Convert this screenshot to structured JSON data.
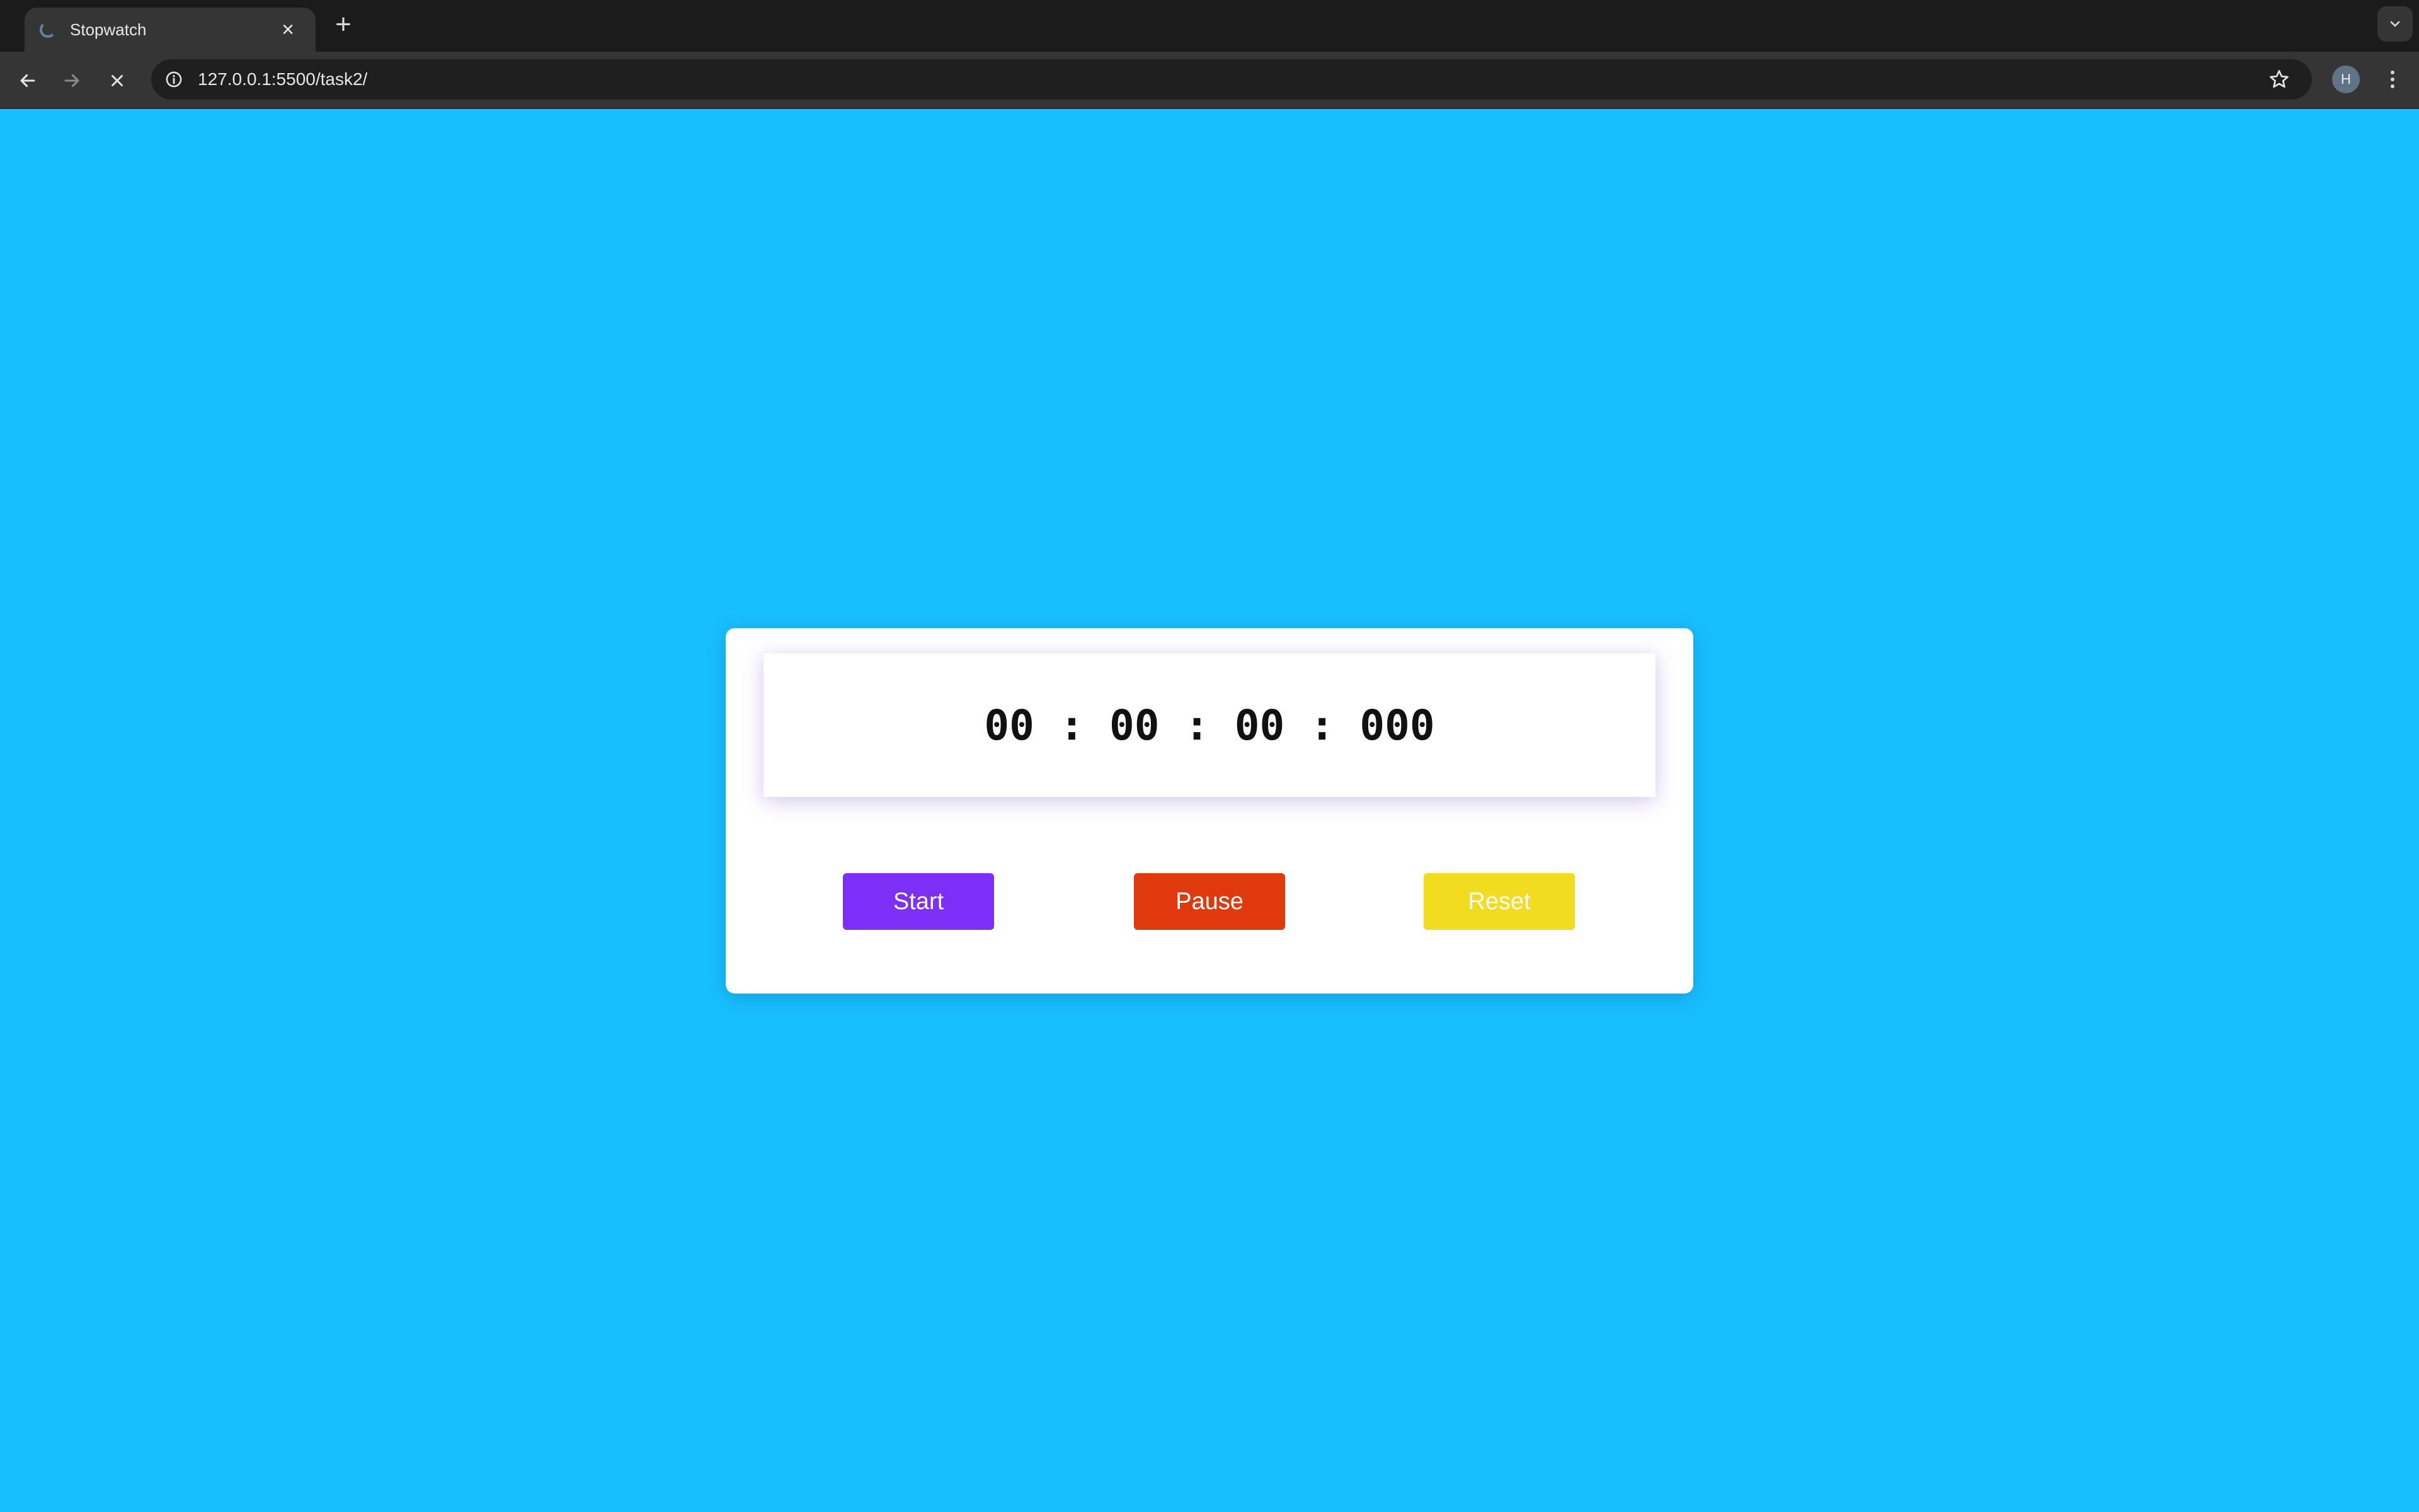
{
  "browser": {
    "tab_title": "Stopwatch",
    "tab_close_glyph": "×",
    "new_tab_glyph": "+",
    "url": "127.0.0.1:5500/task2/",
    "profile_initial": "H"
  },
  "stopwatch": {
    "time_display": "00 : 00 : 00 : 000",
    "buttons": {
      "start_label": "Start",
      "pause_label": "Pause",
      "reset_label": "Reset"
    }
  },
  "colors": {
    "page_background": "#18bfff",
    "start": "#7b2ff7",
    "pause": "#e0390c",
    "reset": "#f2dc1f"
  },
  "icons": [
    "loading-spinner-icon",
    "close-icon",
    "plus-icon",
    "chevron-down-icon",
    "back-arrow-icon",
    "forward-arrow-icon",
    "stop-loading-icon",
    "info-icon",
    "star-icon",
    "kebab-menu-icon"
  ]
}
